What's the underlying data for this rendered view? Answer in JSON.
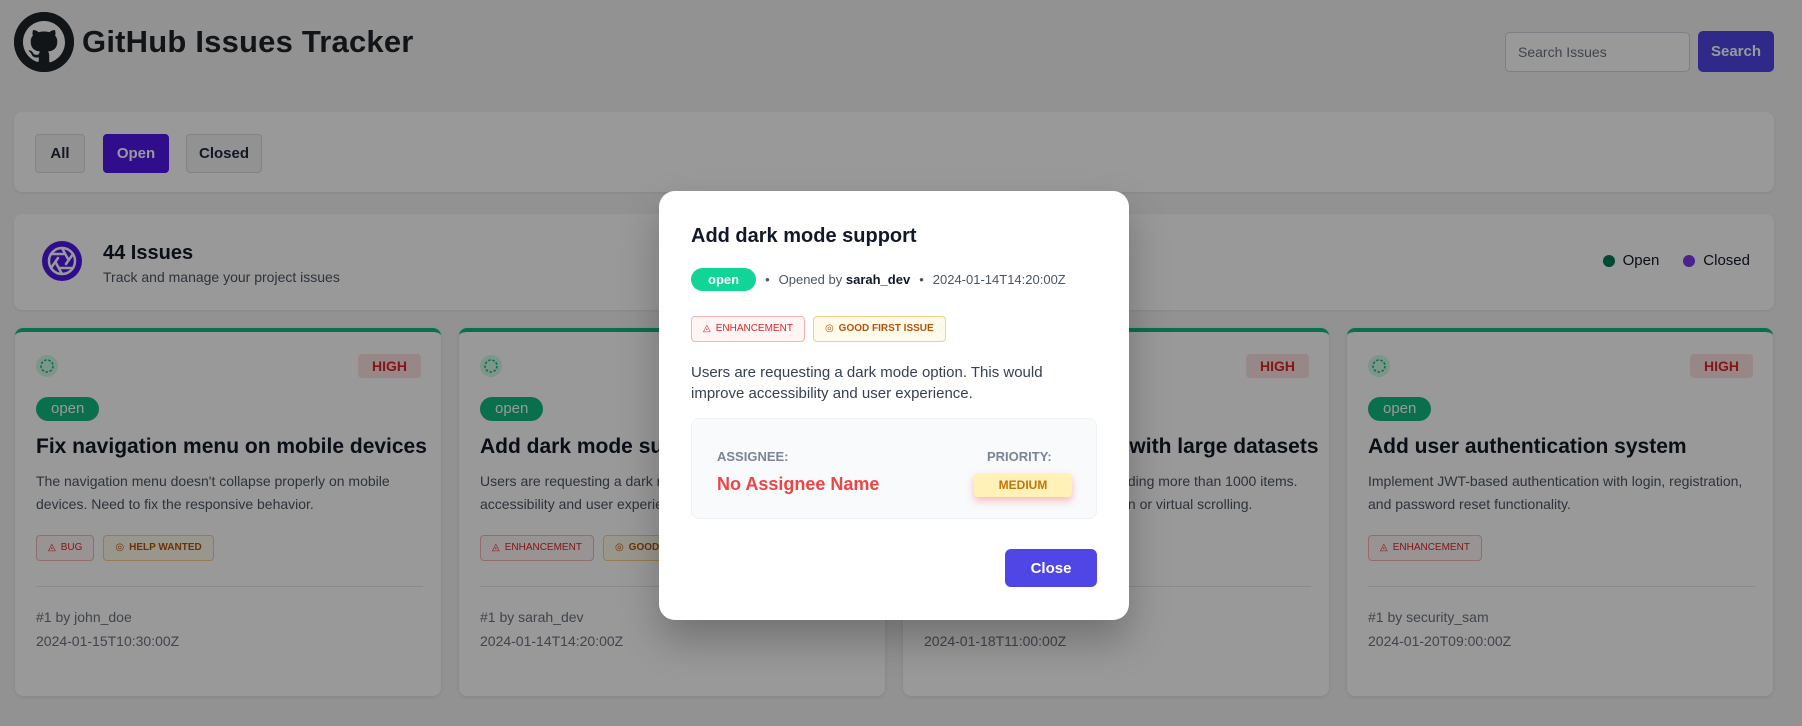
{
  "header": {
    "title": "GitHub Issues Tracker",
    "logo_icon": "github-octocat-icon",
    "search": {
      "placeholder": "Search Issues",
      "value": ""
    },
    "search_button": "Search"
  },
  "filters": [
    {
      "label": "All",
      "active": false
    },
    {
      "label": "Open",
      "active": true
    },
    {
      "label": "Closed",
      "active": false
    }
  ],
  "summary": {
    "count": "44 Issues",
    "subtitle": "Track and manage your project issues",
    "icon": "aperture-icon",
    "legend": [
      {
        "label": "Open",
        "color": "#047857"
      },
      {
        "label": "Closed",
        "color": "#7c3aed"
      }
    ]
  },
  "cards": [
    {
      "priority": "HIGH",
      "state": "open",
      "title": "Fix navigation menu on mobile devices",
      "description": "The navigation menu doesn't collapse properly on mobile devices. Need to fix the responsive behavior.",
      "labels": [
        {
          "text": "BUG",
          "kind": "bug",
          "icon": "bug-icon"
        },
        {
          "text": "HELP WANTED",
          "kind": "help",
          "icon": "lifebuoy-icon"
        }
      ],
      "meta": "#1 by john_doe",
      "date": "2024-01-15T10:30:00Z"
    },
    {
      "priority": "",
      "state": "open",
      "title": "Add dark mode support",
      "description": "Users are requesting a dark mode option. This would improve accessibility and user experience.",
      "labels": [
        {
          "text": "ENHANCEMENT",
          "kind": "enh",
          "icon": "bug-icon"
        },
        {
          "text": "GOOD FIRST ISSUE",
          "kind": "good",
          "icon": "lifebuoy-icon"
        }
      ],
      "meta": "#1 by sarah_dev",
      "date": "2024-01-14T14:20:00Z"
    },
    {
      "priority": "HIGH",
      "state": "open",
      "title": "Performance issues with large datasets",
      "description": "The app becomes slow when loading more than 1000 items. Consider implementing pagination or virtual scrolling.",
      "labels": [],
      "meta": "",
      "date": "2024-01-18T11:00:00Z"
    },
    {
      "priority": "HIGH",
      "state": "open",
      "title": "Add user authentication system",
      "description": "Implement JWT-based authentication with login, registration, and password reset functionality.",
      "labels": [
        {
          "text": "ENHANCEMENT",
          "kind": "enh",
          "icon": "bug-icon"
        }
      ],
      "meta": "#1 by security_sam",
      "date": "2024-01-20T09:00:00Z"
    }
  ],
  "modal": {
    "title": "Add dark mode support",
    "state": "open",
    "opened_prefix": "Opened by",
    "author": "sarah_dev",
    "date": "2024-01-14T14:20:00Z",
    "labels": [
      {
        "text": "ENHANCEMENT",
        "kind": "enh",
        "icon": "bug-icon"
      },
      {
        "text": "GOOD FIRST ISSUE",
        "kind": "good",
        "icon": "lifebuoy-icon"
      }
    ],
    "description": "Users are requesting a dark mode option. This would improve accessibility and user experience.",
    "assignee_label": "ASSIGNEE:",
    "assignee": "No Assignee Name",
    "priority_label": "PRIORITY:",
    "priority": "MEDIUM",
    "close_button": "Close"
  },
  "colors": {
    "accent": "#4f46e5",
    "open_green": "#10b981",
    "high_red": "#dc2626"
  }
}
